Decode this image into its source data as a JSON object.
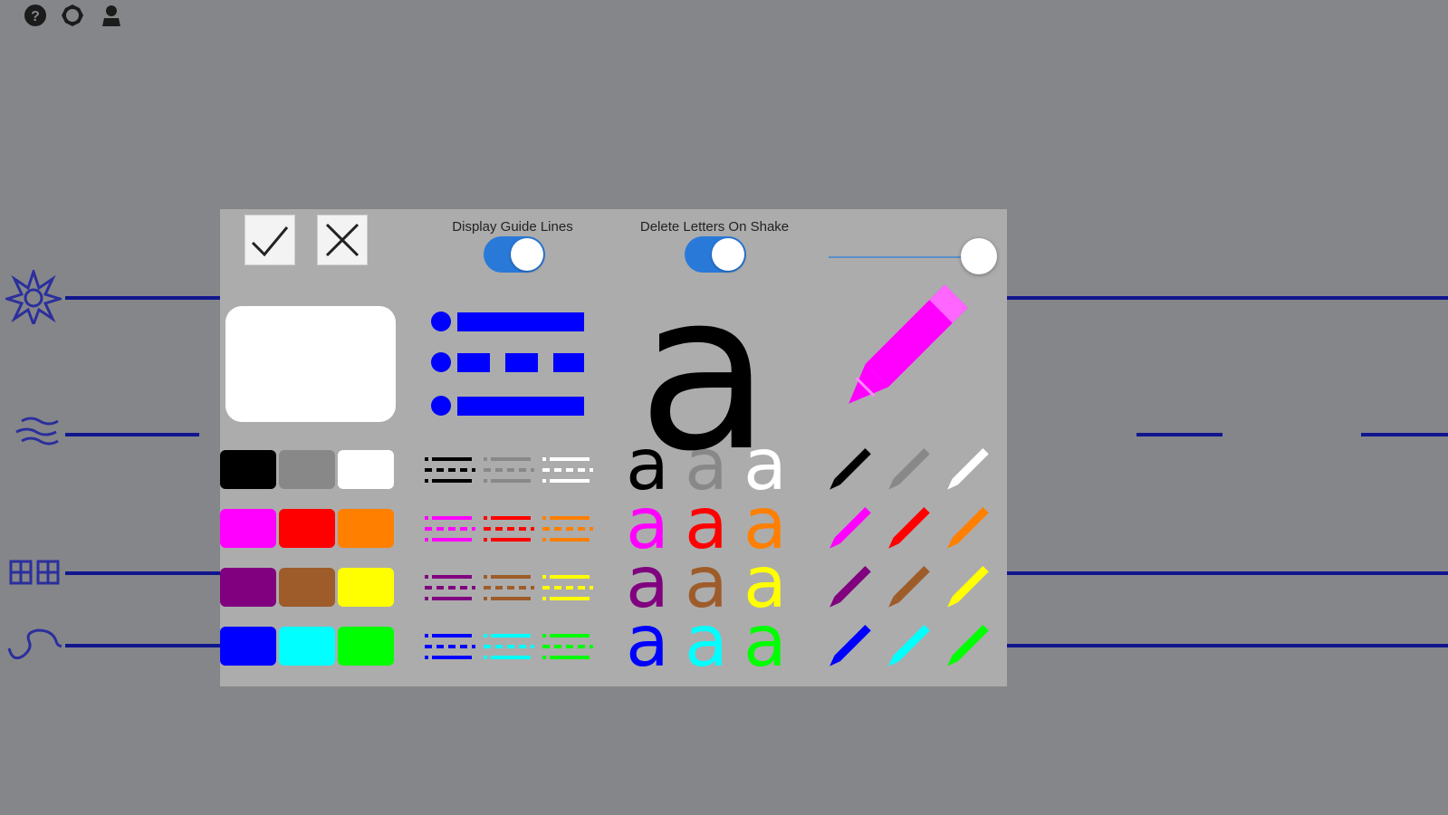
{
  "top_toolbar": {
    "icons": [
      "help-icon",
      "settings-icon",
      "user-icon"
    ]
  },
  "left_icons": [
    "sun-icon",
    "water-icon",
    "grid-icon",
    "wave-icon"
  ],
  "settings_panel": {
    "confirm_icon": "checkmark-icon",
    "cancel_icon": "x-icon",
    "toggles": [
      {
        "label": "Display Guide Lines",
        "on": true
      },
      {
        "label": "Delete Letters On Shake",
        "on": true
      }
    ],
    "pen_size_slider": {
      "value": 1.0
    },
    "preview_letter": "a",
    "letter_char": "a",
    "selected": {
      "background": "#ffffff",
      "line_color": "#0000ff",
      "letter_color": "#000000",
      "pen_color": "#ff00ff"
    },
    "colors": [
      [
        "#000000",
        "#888888",
        "#ffffff"
      ],
      [
        "#ff00ff",
        "#ff0000",
        "#ff7f00"
      ],
      [
        "#800080",
        "#9e5c2a",
        "#ffff00"
      ],
      [
        "#0000ff",
        "#00ffff",
        "#00ff00"
      ]
    ]
  }
}
